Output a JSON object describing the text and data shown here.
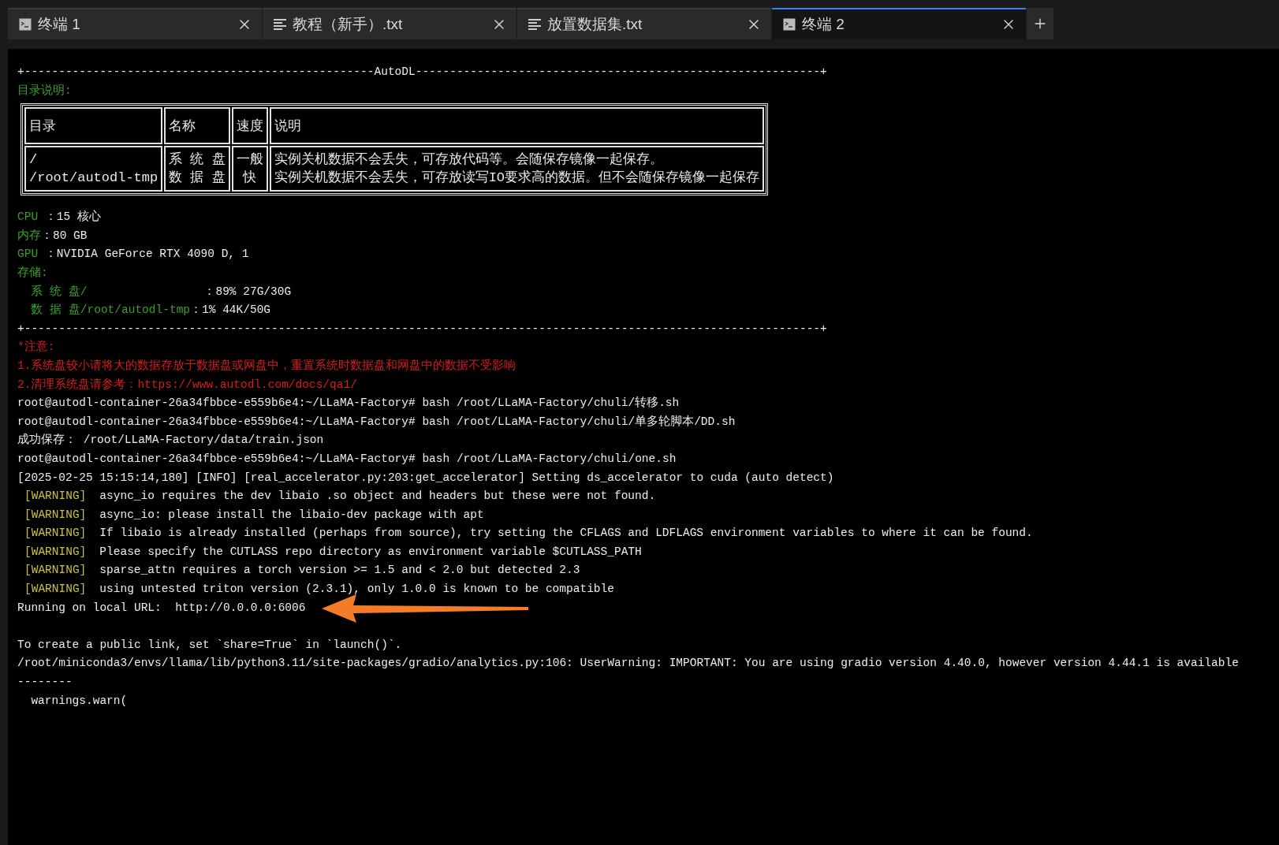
{
  "tabs": [
    {
      "kind": "terminal",
      "label": "终端 1",
      "selected": false
    },
    {
      "kind": "text",
      "label": "教程（新手）.txt",
      "selected": false
    },
    {
      "kind": "text",
      "label": "放置数据集.txt",
      "selected": false
    },
    {
      "kind": "terminal",
      "label": "终端 2",
      "selected": true
    }
  ],
  "terminal": {
    "blocks": [
      {
        "kind": "line",
        "segments": [
          {
            "color": "#ececec",
            "text": "+---------------------------------------------------AutoDL-----------------------------------------------------------+"
          }
        ]
      },
      {
        "kind": "line",
        "segments": [
          {
            "color": "#3aa02c",
            "text": "目录说明:"
          }
        ]
      },
      {
        "kind": "table",
        "columns": [
          "目录",
          "名称",
          "速度",
          "说明"
        ],
        "rows": [
          {
            "cells": [
              [
                "/",
                "/root/autodl-tmp"
              ],
              [
                "系 统 盘",
                "数 据 盘"
              ],
              [
                "一般",
                "快"
              ],
              [
                "实例关机数据不会丢失，可存放代码等。会随保存镜像一起保存。",
                "实例关机数据不会丢失，可存放读写IO要求高的数据。但不会随保存镜像一起保存"
              ]
            ]
          }
        ]
      },
      {
        "kind": "line",
        "segments": [
          {
            "color": "#3aa02c",
            "text": "CPU"
          },
          {
            "color": "#ececec",
            "text": " ：15 核心"
          }
        ]
      },
      {
        "kind": "line",
        "segments": [
          {
            "color": "#3aa02c",
            "text": "内存"
          },
          {
            "color": "#ececec",
            "text": "：80 GB"
          }
        ]
      },
      {
        "kind": "line",
        "segments": [
          {
            "color": "#3aa02c",
            "text": "GPU"
          },
          {
            "color": "#ececec",
            "text": " ：NVIDIA GeForce RTX 4090 D, 1"
          }
        ]
      },
      {
        "kind": "line",
        "segments": [
          {
            "color": "#3aa02c",
            "text": "存储:"
          }
        ]
      },
      {
        "kind": "line",
        "segments": [
          {
            "color": "#3aa02c",
            "text": "  系 统 盘/"
          },
          {
            "color": "#ececec",
            "text": "                 ：89% 27G/30G"
          }
        ]
      },
      {
        "kind": "line",
        "segments": [
          {
            "color": "#3aa02c",
            "text": "  数 据 盘/root/autodl-tmp"
          },
          {
            "color": "#ececec",
            "text": "：1% 44K/50G"
          }
        ]
      },
      {
        "kind": "line",
        "segments": [
          {
            "color": "#ececec",
            "text": "+--------------------------------------------------------------------------------------------------------------------+"
          }
        ]
      },
      {
        "kind": "line",
        "segments": [
          {
            "color": "#d81b1b",
            "text": "*注意:"
          }
        ]
      },
      {
        "kind": "line",
        "segments": [
          {
            "color": "#d81b1b",
            "text": "1.系统盘较小请将大的数据存放于数据盘或网盘中，重置系统时数据盘和网盘中的数据不受影响"
          }
        ]
      },
      {
        "kind": "line",
        "segments": [
          {
            "color": "#d81b1b",
            "text": "2.清理系统盘请参考：https://www.autodl.com/docs/qa1/"
          }
        ]
      },
      {
        "kind": "line",
        "segments": [
          {
            "color": "#ececec",
            "text": "root@autodl-container-26a34fbbce-e559b6e4:~/LLaMA-Factory# bash /root/LLaMA-Factory/chuli/转移.sh"
          }
        ]
      },
      {
        "kind": "line",
        "segments": [
          {
            "color": "#ececec",
            "text": "root@autodl-container-26a34fbbce-e559b6e4:~/LLaMA-Factory# bash /root/LLaMA-Factory/chuli/单多轮脚本/DD.sh"
          }
        ]
      },
      {
        "kind": "line",
        "segments": [
          {
            "color": "#ececec",
            "text": "成功保存： /root/LLaMA-Factory/data/train.json"
          }
        ]
      },
      {
        "kind": "line",
        "segments": [
          {
            "color": "#ececec",
            "text": "root@autodl-container-26a34fbbce-e559b6e4:~/LLaMA-Factory# bash /root/LLaMA-Factory/chuli/one.sh"
          }
        ]
      },
      {
        "kind": "line",
        "segments": [
          {
            "color": "#ececec",
            "text": "[2025-02-25 15:15:14,180] [INFO] [real_accelerator.py:203:get_accelerator] Setting ds_accelerator to cuda (auto detect)"
          }
        ]
      },
      {
        "kind": "warning",
        "tag": "[WARNING]",
        "text": "async_io requires the dev libaio .so object and headers but these were not found."
      },
      {
        "kind": "warning",
        "tag": "[WARNING]",
        "text": "async_io: please install the libaio-dev package with apt"
      },
      {
        "kind": "warning",
        "tag": "[WARNING]",
        "text": "If libaio is already installed (perhaps from source), try setting the CFLAGS and LDFLAGS environment variables to where it can be found."
      },
      {
        "kind": "warning",
        "tag": "[WARNING]",
        "text": "Please specify the CUTLASS repo directory as environment variable $CUTLASS_PATH"
      },
      {
        "kind": "warning",
        "tag": "[WARNING]",
        "text": "sparse_attn requires a torch version >= 1.5 and < 2.0 but detected 2.3"
      },
      {
        "kind": "warning",
        "tag": "[WARNING]",
        "text": "using untested triton version (2.3.1), only 1.0.0 is known to be compatible"
      },
      {
        "kind": "line",
        "arrow": true,
        "segments": [
          {
            "color": "#ececec",
            "text": "Running on local URL:  http://0.0.0.0:6006"
          }
        ]
      },
      {
        "kind": "blank"
      },
      {
        "kind": "line",
        "segments": [
          {
            "color": "#ececec",
            "text": "To create a public link, set `share=True` in `launch()`."
          }
        ]
      },
      {
        "kind": "line",
        "segments": [
          {
            "color": "#ececec",
            "text": "/root/miniconda3/envs/llama/lib/python3.11/site-packages/gradio/analytics.py:106: UserWarning: IMPORTANT: You are using gradio version 4.40.0, however version 4.44.1 is available"
          }
        ]
      },
      {
        "kind": "line",
        "segments": [
          {
            "color": "#ececec",
            "text": "--------"
          }
        ]
      },
      {
        "kind": "line",
        "segments": [
          {
            "color": "#ececec",
            "text": "  warnings.warn("
          }
        ]
      }
    ]
  }
}
